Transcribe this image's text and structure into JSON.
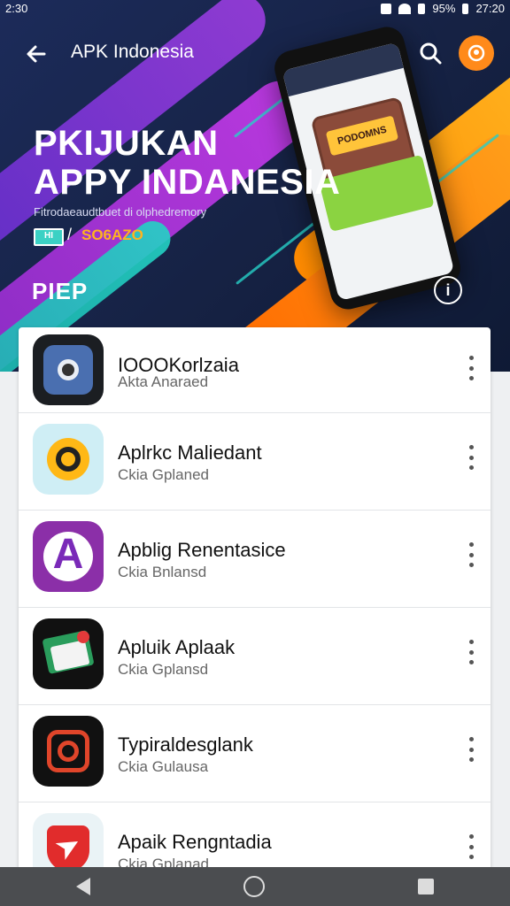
{
  "status_bar": {
    "time_left": "2:30",
    "battery": "95%",
    "time_right": "27:20"
  },
  "app_bar": {
    "title": "APK Indonesia"
  },
  "hero": {
    "headline_line1": "PKIJUKAN",
    "headline_line2": "APPY INDANESIA",
    "subtitle": "Fitrodaeaudtbuet di olphedremory",
    "badge": "HI",
    "code": "SO6AZO",
    "section_label": "PIEP",
    "phone_card_text": "PODOMNS",
    "info_label": "i"
  },
  "apps": [
    {
      "title": "IOOOKorlzaia",
      "subtitle": "Akta Anaraed",
      "icon": "camera-app-icon"
    },
    {
      "title": "Aplrkc Maliedant",
      "subtitle": "Ckia Gplaned",
      "icon": "target-app-icon"
    },
    {
      "title": "Apblig Renentasice",
      "subtitle": "Ckia Bnlansd",
      "icon": "letter-a-app-icon"
    },
    {
      "title": "Apluik Aplaak",
      "subtitle": "Ckia Gplansd",
      "icon": "mail-app-icon"
    },
    {
      "title": "Typiraldesglank",
      "subtitle": "Ckia Gulausa",
      "icon": "target-square-app-icon"
    },
    {
      "title": "Apaik Rengntadia",
      "subtitle": "Ckia Gplanad",
      "icon": "shield-arrow-app-icon"
    }
  ]
}
